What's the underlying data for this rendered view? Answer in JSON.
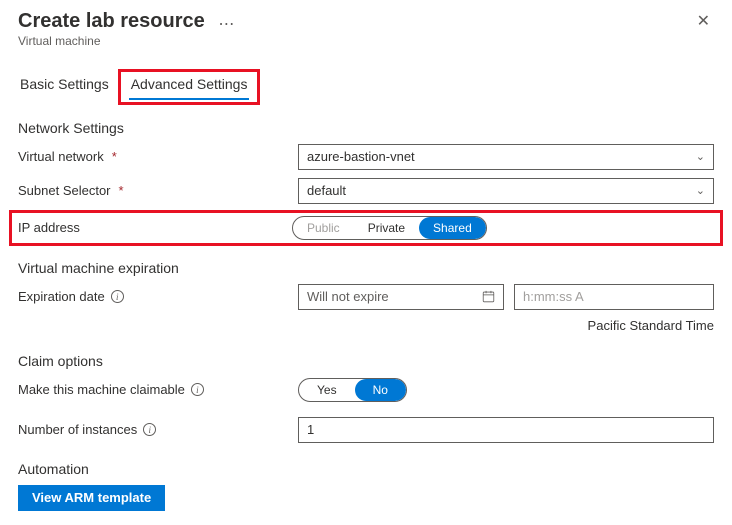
{
  "header": {
    "title": "Create lab resource",
    "subtitle": "Virtual machine"
  },
  "tabs": {
    "basic": "Basic Settings",
    "advanced": "Advanced Settings"
  },
  "network": {
    "section": "Network Settings",
    "vnet_label": "Virtual network",
    "vnet_value": "azure-bastion-vnet",
    "subnet_label": "Subnet Selector",
    "subnet_value": "default",
    "ip_label": "IP address",
    "ip_options": {
      "public": "Public",
      "private": "Private",
      "shared": "Shared"
    }
  },
  "expiration": {
    "section": "Virtual machine expiration",
    "date_label": "Expiration date",
    "date_value": "Will not expire",
    "time_placeholder": "h:mm:ss A",
    "tz": "Pacific Standard Time"
  },
  "claim": {
    "section": "Claim options",
    "claimable_label": "Make this machine claimable",
    "yes": "Yes",
    "no": "No",
    "instances_label": "Number of instances",
    "instances_value": "1"
  },
  "automation": {
    "section": "Automation",
    "view_arm": "View ARM template"
  }
}
